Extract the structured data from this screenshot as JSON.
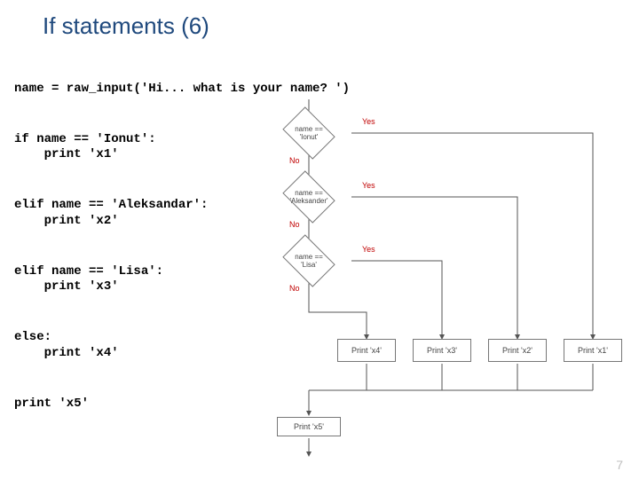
{
  "title": "If statements (6)",
  "page_number": "7",
  "code": {
    "l1": "name = raw_input('Hi... what is your name? ')",
    "l2": "if name == 'Ionut':",
    "l3": "    print 'x1'",
    "l4": "elif name == 'Aleksandar':",
    "l5": "    print 'x2'",
    "l6": "elif name == 'Lisa':",
    "l7": "    print 'x3'",
    "l8": "else:",
    "l9": "    print 'x4'",
    "l10": "print 'x5'"
  },
  "flow": {
    "d1": "name == 'Ionut'",
    "d2": "name == 'Aleksander'",
    "d3": "name == 'Lisa'",
    "p1": "Print 'x1'",
    "p2": "Print 'x2'",
    "p3": "Print 'x3'",
    "p4": "Print 'x4'",
    "p5": "Print 'x5'",
    "yes": "Yes",
    "no": "No"
  }
}
